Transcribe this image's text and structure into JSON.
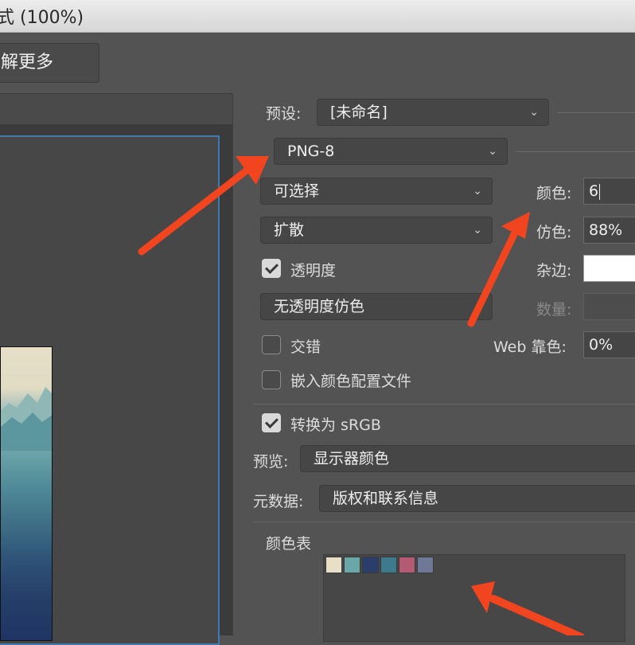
{
  "window": {
    "title": "式 (100%)"
  },
  "toolbar": {
    "learn_more_label": "解更多"
  },
  "settings": {
    "preset_label": "预设:",
    "preset_value": "[未命名]",
    "format_value": "PNG-8",
    "reduction_value": "可选择",
    "dither_algo_value": "扩散",
    "transparency_label": "透明度",
    "transparency_checked": true,
    "transparency_dither_value": "无透明度仿色",
    "interlaced_label": "交错",
    "interlaced_checked": false,
    "embed_profile_label": "嵌入颜色配置文件",
    "embed_profile_checked": false,
    "colors_label": "颜色:",
    "colors_value": "6",
    "dither_label": "仿色:",
    "dither_value": "88%",
    "matte_label": "杂边:",
    "matte_color": "#ffffff",
    "amount_label": "数量:",
    "web_snap_label": "Web 靠色:",
    "web_snap_value": "0%"
  },
  "conversion": {
    "srgb_label": "转换为 sRGB",
    "srgb_checked": true,
    "preview_label": "预览:",
    "preview_value": "显示器颜色",
    "metadata_label": "元数据:",
    "metadata_value": "版权和联系信息"
  },
  "color_table": {
    "title": "颜色表",
    "swatches": [
      "#e8dfc7",
      "#6aa7a8",
      "#2a3d6b",
      "#3d7a8e",
      "#b45a73",
      "#6f7896"
    ]
  },
  "annotations": {
    "arrow_color": "#f0451f"
  }
}
